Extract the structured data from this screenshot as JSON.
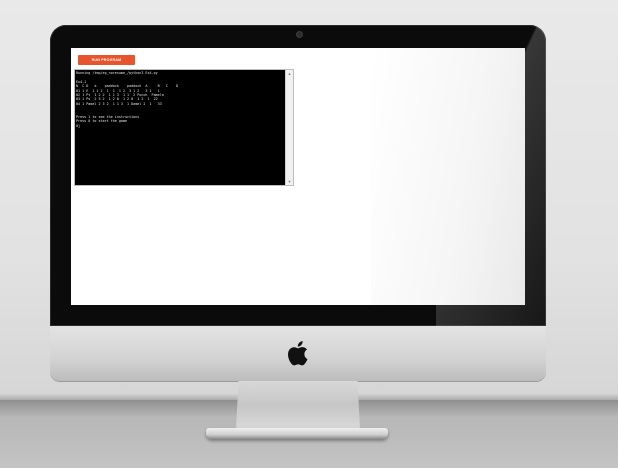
{
  "screen": {
    "run_button_label": "RUN PROGRAM",
    "console": {
      "lines": [
        "Running /tmp/ep_noresume_/python3 Ex4.py",
        "",
        "Ex4-1",
        "N  C D   a    paddock    paddock  A     B   C    D",
        "01 1 E  1 1 2  1  1  1 2  3 1 2   3 1   1",
        "02 1 Pt  1 2 2  1 1 3  1 1  2 Punch  Pamela",
        "03 1 Ps  2 5 2  1 2 0  1 2 0  1 2  1  22",
        "04 1 Pamel 2 3 2  1 1 3  1 Damel 2  1   33",
        "",
        "",
        "Press 1 to see the instructions",
        "Press 0 to start the game",
        "0]"
      ],
      "scroll_up_glyph": "▲",
      "scroll_down_glyph": "▼"
    }
  },
  "colors": {
    "run_button": "#e8542b",
    "console_bg": "#000000",
    "console_text": "#e6e6e6"
  },
  "icons": {
    "logo": "apple-logo-icon",
    "camera": "camera-icon"
  }
}
